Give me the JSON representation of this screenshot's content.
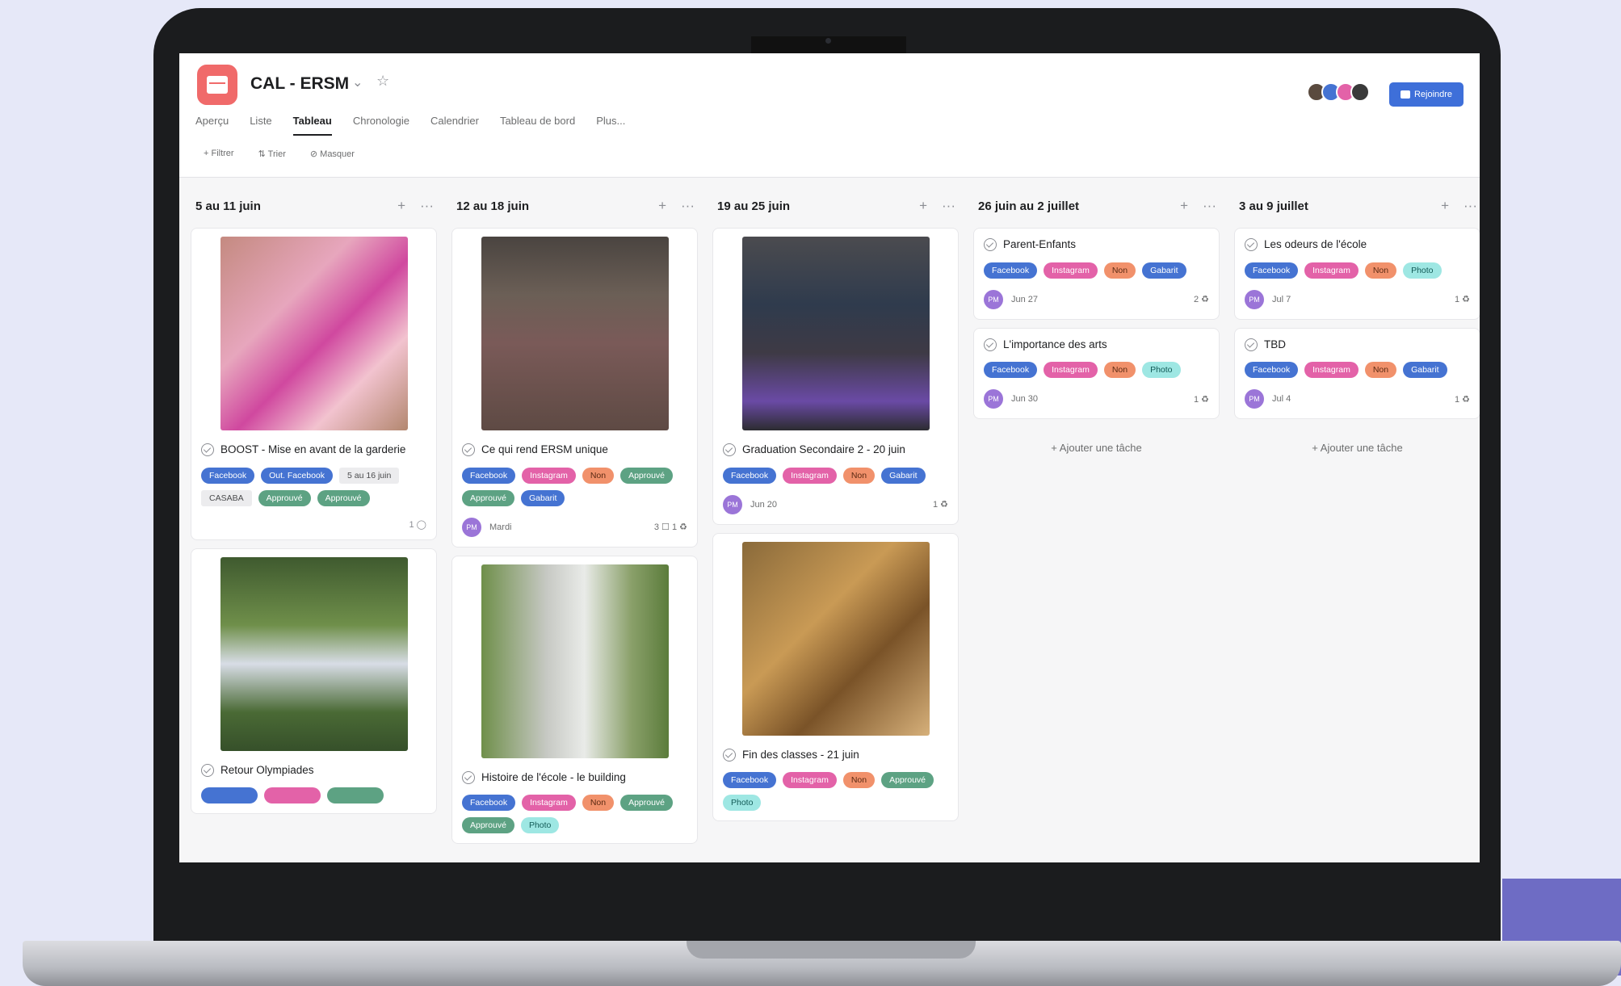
{
  "project": {
    "title": "CAL - ERSM"
  },
  "join_label": "Rejoindre",
  "tabs": [
    "Aperçu",
    "Liste",
    "Tableau",
    "Chronologie",
    "Calendrier",
    "Tableau de bord",
    "Plus..."
  ],
  "active_tab": "Tableau",
  "toolbar": {
    "filter": "Filtrer",
    "sort": "Trier",
    "hide": "Masquer"
  },
  "add_task_label": "Ajouter une tâche",
  "colors": {
    "facebook": "#4573d2",
    "instagram": "#e362a8",
    "orange": "#f1916b",
    "green": "#5da283",
    "teal": "#9ee7e3",
    "join": "#3e6fd9",
    "project_icon": "#f06a6a"
  },
  "columns": [
    {
      "title": "5 au 11 juin",
      "cards": [
        {
          "title": "BOOST - Mise en avant de la garderie",
          "image": "pink-craft-photo",
          "tags": [
            {
              "label": "Facebook",
              "color": "blue"
            },
            {
              "label": "Out. Facebook",
              "color": "blue"
            },
            {
              "label": "5 au 16 juin",
              "color": "gray"
            },
            {
              "label": "CASABA",
              "color": "gray"
            },
            {
              "label": "Approuvé",
              "color": "green"
            },
            {
              "label": "Approuvé",
              "color": "green"
            }
          ],
          "comments": "1"
        },
        {
          "title": "Retour Olympiades",
          "image": "kids-outdoor-photo",
          "tags": [],
          "cut": true
        }
      ]
    },
    {
      "title": "12 au 18 juin",
      "cards": [
        {
          "title": "Ce qui rend ERSM unique",
          "image": "slide-photo",
          "tags": [
            {
              "label": "Facebook",
              "color": "blue"
            },
            {
              "label": "Instagram",
              "color": "pink"
            },
            {
              "label": "Non",
              "color": "orange"
            },
            {
              "label": "Approuvé",
              "color": "green"
            },
            {
              "label": "Approuvé",
              "color": "green"
            },
            {
              "label": "Gabarit",
              "color": "blue"
            }
          ],
          "avatar": "PM",
          "date": "Mardi",
          "right": "3 ☐   1 ♻"
        },
        {
          "title": "Histoire de l'école - le building",
          "image": "building-photo",
          "tags": [
            {
              "label": "Facebook",
              "color": "blue"
            },
            {
              "label": "Instagram",
              "color": "pink"
            },
            {
              "label": "Non",
              "color": "orange"
            },
            {
              "label": "Approuvé",
              "color": "green"
            },
            {
              "label": "Approuvé",
              "color": "green"
            },
            {
              "label": "Photo",
              "color": "teal"
            }
          ]
        }
      ]
    },
    {
      "title": "19 au 25 juin",
      "cards": [
        {
          "title": "Graduation Secondaire 2 - 20 juin",
          "image": "classroom-photo",
          "tags": [
            {
              "label": "Facebook",
              "color": "blue"
            },
            {
              "label": "Instagram",
              "color": "pink"
            },
            {
              "label": "Non",
              "color": "orange"
            },
            {
              "label": "Gabarit",
              "color": "blue"
            }
          ],
          "avatar": "PM",
          "date": "Jun 20",
          "right": "1 ♻"
        },
        {
          "title": "Fin des classes - 21 juin",
          "image": "cafeteria-photo",
          "tags": [
            {
              "label": "Facebook",
              "color": "blue"
            },
            {
              "label": "Instagram",
              "color": "pink"
            },
            {
              "label": "Non",
              "color": "orange"
            },
            {
              "label": "Approuvé",
              "color": "green"
            },
            {
              "label": "Photo",
              "color": "teal"
            }
          ]
        }
      ]
    },
    {
      "title": "26 juin au 2 juillet",
      "cards": [
        {
          "title": "Parent-Enfants",
          "tags": [
            {
              "label": "Facebook",
              "color": "blue"
            },
            {
              "label": "Instagram",
              "color": "pink"
            },
            {
              "label": "Non",
              "color": "orange"
            },
            {
              "label": "Gabarit",
              "color": "blue"
            }
          ],
          "avatar": "PM",
          "date": "Jun 27",
          "right": "2 ♻"
        },
        {
          "title": "L'importance des arts",
          "tags": [
            {
              "label": "Facebook",
              "color": "blue"
            },
            {
              "label": "Instagram",
              "color": "pink"
            },
            {
              "label": "Non",
              "color": "orange"
            },
            {
              "label": "Photo",
              "color": "teal"
            }
          ],
          "avatar": "PM",
          "date": "Jun 30",
          "right": "1 ♻"
        }
      ],
      "add_task": true
    },
    {
      "title": "3 au 9 juillet",
      "cards": [
        {
          "title": "Les odeurs de l'école",
          "tags": [
            {
              "label": "Facebook",
              "color": "blue"
            },
            {
              "label": "Instagram",
              "color": "pink"
            },
            {
              "label": "Non",
              "color": "orange"
            },
            {
              "label": "Photo",
              "color": "teal"
            }
          ],
          "avatar": "PM",
          "date": "Jul 7",
          "right": "1 ♻"
        },
        {
          "title": "TBD",
          "tags": [
            {
              "label": "Facebook",
              "color": "blue"
            },
            {
              "label": "Instagram",
              "color": "pink"
            },
            {
              "label": "Non",
              "color": "orange"
            },
            {
              "label": "Gabarit",
              "color": "blue"
            }
          ],
          "avatar": "PM",
          "date": "Jul 4",
          "right": "1 ♻"
        }
      ],
      "add_task": true
    }
  ]
}
